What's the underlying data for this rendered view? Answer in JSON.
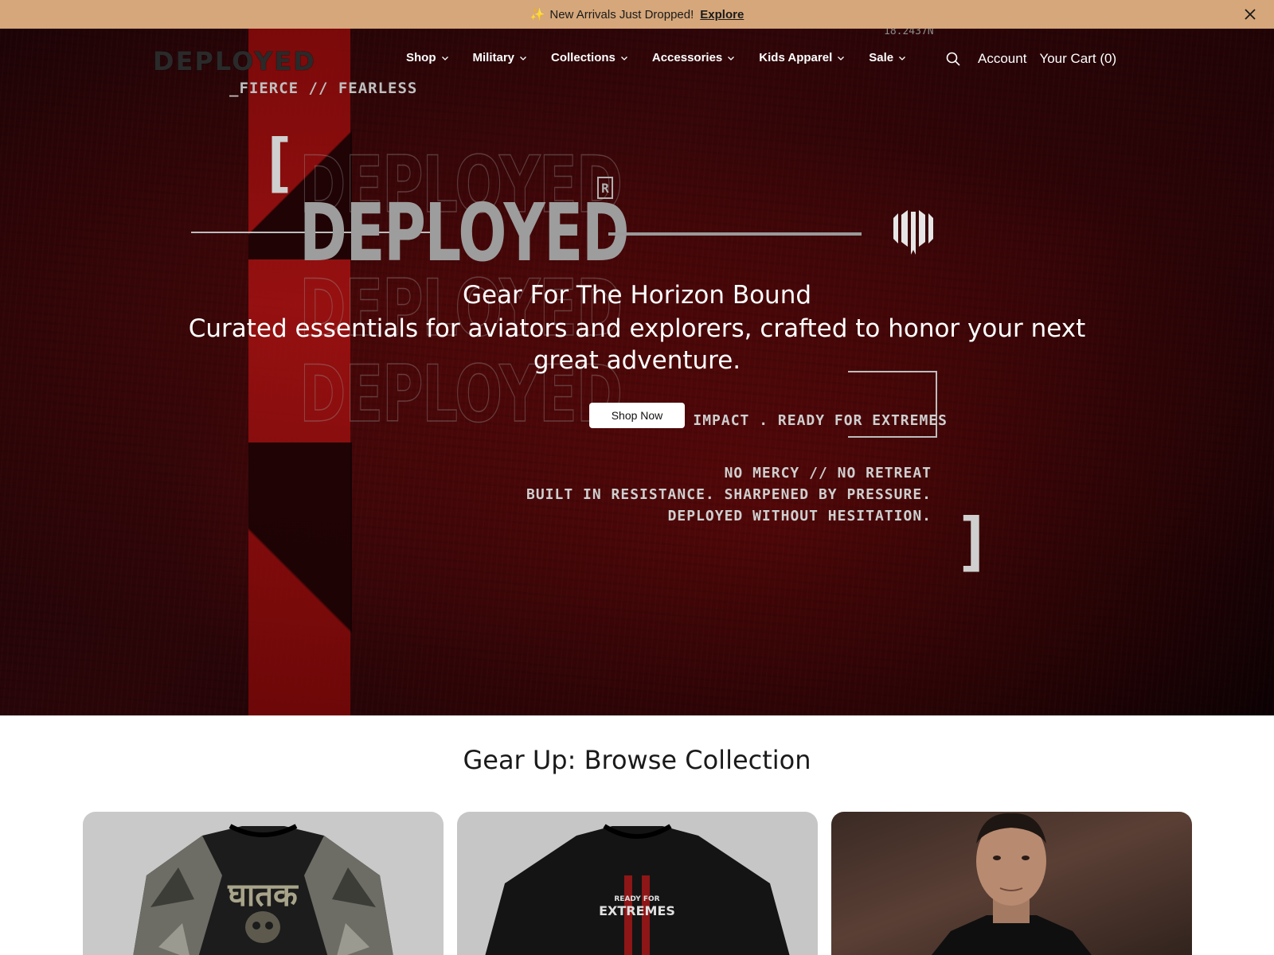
{
  "announcement": {
    "sparkle": "✨",
    "text": "New Arrivals Just Dropped!",
    "link_label": "Explore"
  },
  "header": {
    "logo": "DEPLOYED",
    "tagline": "_FIERCE // FEARLESS",
    "coordinate": "18.2437N",
    "nav": [
      {
        "label": "Shop"
      },
      {
        "label": "Military"
      },
      {
        "label": "Collections"
      },
      {
        "label": "Accessories"
      },
      {
        "label": "Kids Apparel"
      },
      {
        "label": "Sale"
      }
    ],
    "account_label": "Account",
    "cart_label": "Your Cart (0)"
  },
  "hero": {
    "brand_word": "DEPLOYED",
    "reg_mark": "R",
    "bracket_open": "[",
    "bracket_close": "]",
    "impact_text": "BUILT FOR IMPACT . READY FOR EXTREMES",
    "manifesto": [
      "NO MERCY // NO RETREAT",
      "BUILT IN RESISTANCE. SHARPENED BY PRESSURE.",
      "DEPLOYED WITHOUT HESITATION."
    ],
    "title": "Gear For The Horizon Bound",
    "subtitle": "Curated essentials for aviators and explorers, crafted to honor your next great adventure.",
    "cta_label": "Shop Now"
  },
  "collection": {
    "title": "Gear Up: Browse Collection",
    "cards": [
      {
        "graphic_text": "घातक"
      },
      {
        "graphic_text_top": "READY FOR",
        "graphic_text_main": "EXTREMES"
      },
      {}
    ]
  },
  "colors": {
    "announcement_bg": "#d6a77a",
    "hero_red": "#a51212",
    "hero_dark": "#1a0306"
  }
}
